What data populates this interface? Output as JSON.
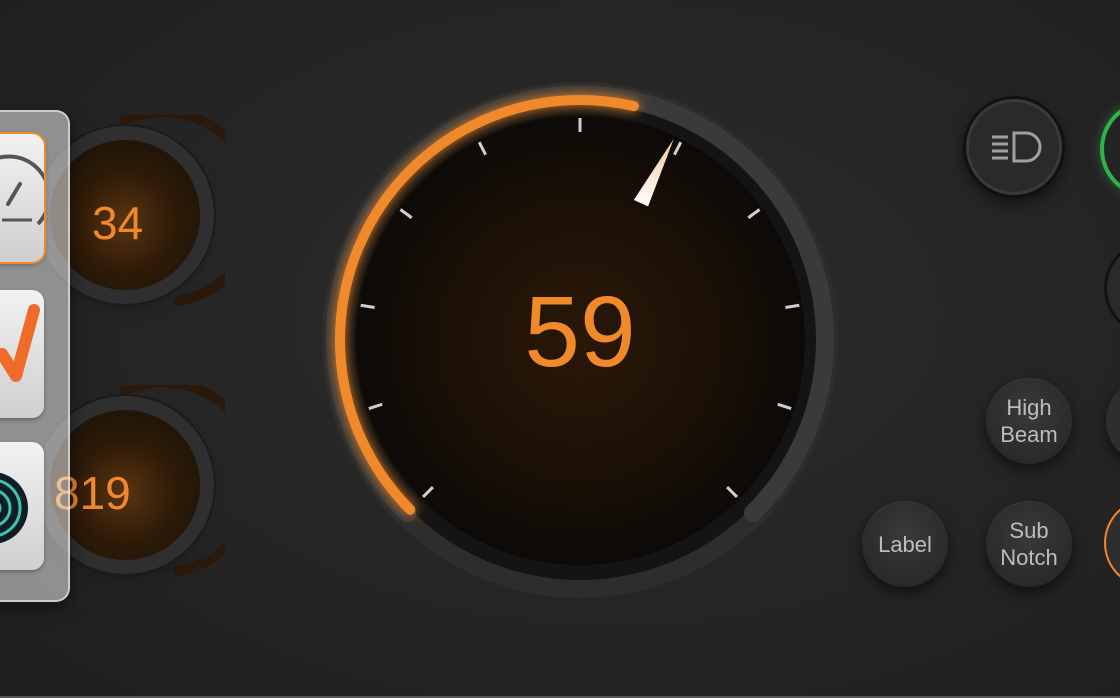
{
  "main_gauge": {
    "value": "59",
    "accent_color": "#f0892a",
    "progress_arc_color": "#f0892a"
  },
  "mini_gauges": [
    {
      "value": "34"
    },
    {
      "value": "819"
    }
  ],
  "dock": {
    "items": [
      {
        "icon": "speedometer-icon",
        "active": true
      },
      {
        "icon": "checkmark-icon",
        "active": false
      },
      {
        "icon": "target-icon",
        "active": false
      }
    ]
  },
  "buttons": {
    "headlight_icon": "headlight-icon",
    "high_beam": {
      "line1": "High",
      "line2": "Beam"
    },
    "label": "Label",
    "sub_notch": {
      "line1": "Sub",
      "line2": "Notch"
    }
  },
  "colors": {
    "background": "#262626",
    "accent": "#f0892a",
    "status_green": "#2fb34a"
  }
}
